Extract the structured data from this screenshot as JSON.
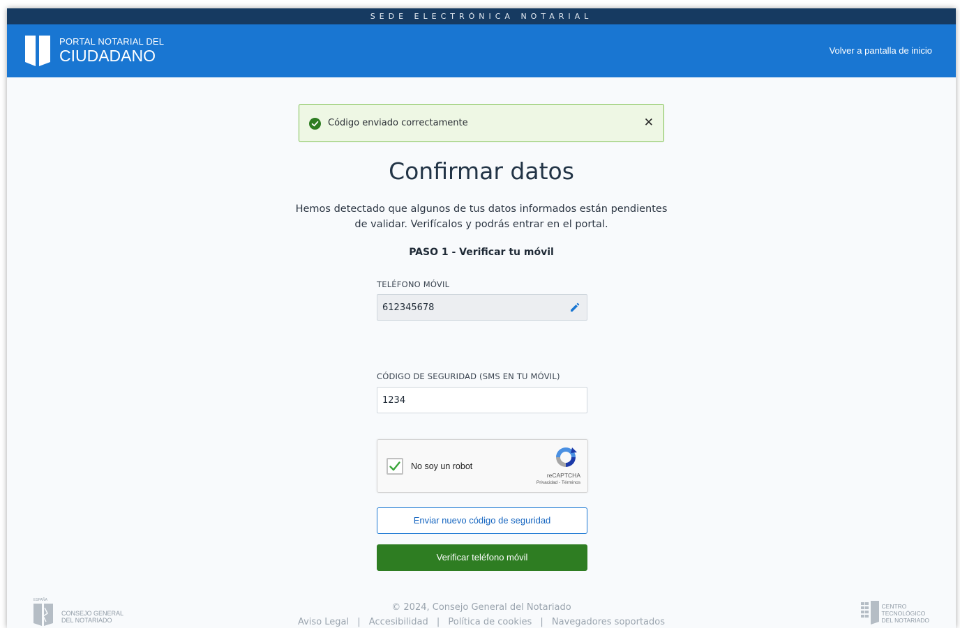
{
  "topbar": {
    "text": "SEDE ELECTRÓNICA NOTARIAL"
  },
  "header": {
    "logo_line1": "PORTAL NOTARIAL DEL",
    "logo_line2": "CIUDADANO",
    "back_link": "Volver a pantalla de inicio"
  },
  "alert": {
    "message": "Código enviado correctamente",
    "close": "✕"
  },
  "main": {
    "title": "Confirmar datos",
    "description": "Hemos detectado que algunos de tus datos informados están pendientes de validar. Verifícalos y podrás entrar en el portal.",
    "step": "PASO 1 - Verificar tu móvil"
  },
  "phone": {
    "label": "TELÉFONO MÓVIL",
    "value": "612345678"
  },
  "code": {
    "label": "CÓDIGO DE SEGURIDAD (SMS EN TU MÓVIL)",
    "value": "1234"
  },
  "captcha": {
    "label": "No soy un robot",
    "brand": "reCAPTCHA",
    "links": "Privacidad - Términos",
    "checked": true
  },
  "buttons": {
    "resend": "Enviar nuevo código de seguridad",
    "verify": "Verificar teléfono móvil"
  },
  "footer": {
    "left_small": "ESPAÑA",
    "left_line1": "CONSEJO GENERAL",
    "left_line2": "DEL NOTARIADO",
    "copyright": "© 2024, Consejo General del Notariado",
    "links": [
      "Aviso Legal",
      "Accesibilidad",
      "Política de cookies",
      "Navegadores soportados"
    ],
    "separator": "|",
    "right_line1": "CENTRO",
    "right_line2": "TECNOLÓGICO",
    "right_line3": "DEL NOTARIADO"
  },
  "colors": {
    "header_blue": "#1976d2",
    "topbar_navy": "#163a61",
    "success_green": "#2e7d22",
    "alert_bg": "#eef7e4"
  },
  "icons": {
    "alert": "check-circle-icon",
    "close": "close-icon",
    "edit": "pencil-icon",
    "captcha": "recaptcha-icon"
  }
}
